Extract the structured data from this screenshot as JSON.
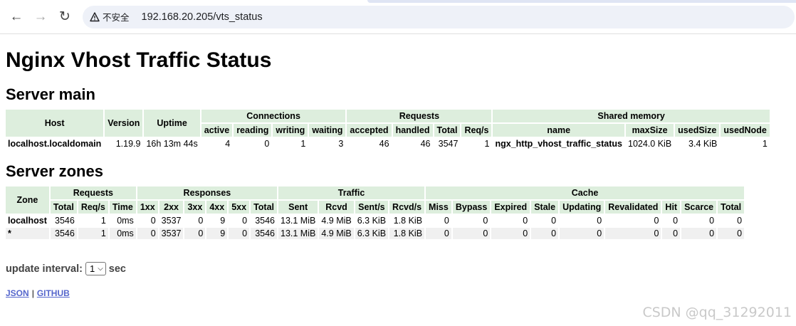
{
  "browser": {
    "back_icon": "arrow-left-icon",
    "forward_icon": "arrow-right-icon",
    "reload_icon": "reload-icon",
    "security_label": "不安全",
    "url": "192.168.20.205/vts_status"
  },
  "page": {
    "title": "Nginx Vhost Traffic Status",
    "server_main_heading": "Server main",
    "server_zones_heading": "Server zones",
    "update_interval_label": "update interval:",
    "update_interval_value": "1",
    "update_interval_unit": "sec",
    "link_json": "JSON",
    "link_separator": "|",
    "link_github": "GITHUB",
    "watermark": "CSDN @qq_31292011"
  },
  "server_main": {
    "group_headers": {
      "host": "Host",
      "version": "Version",
      "uptime": "Uptime",
      "connections": "Connections",
      "requests": "Requests",
      "shared_memory": "Shared memory"
    },
    "sub_headers": [
      "active",
      "reading",
      "writing",
      "waiting",
      "accepted",
      "handled",
      "Total",
      "Req/s",
      "name",
      "maxSize",
      "usedSize",
      "usedNode"
    ],
    "row": [
      "localhost.localdomain",
      "1.19.9",
      "16h 13m 44s",
      "4",
      "0",
      "1",
      "3",
      "46",
      "46",
      "3547",
      "1",
      "ngx_http_vhost_traffic_status",
      "1024.0 KiB",
      "3.4 KiB",
      "1"
    ]
  },
  "server_zones": {
    "group_headers": {
      "zone": "Zone",
      "requests": "Requests",
      "responses": "Responses",
      "traffic": "Traffic",
      "cache": "Cache"
    },
    "sub_headers": [
      "Total",
      "Req/s",
      "Time",
      "1xx",
      "2xx",
      "3xx",
      "4xx",
      "5xx",
      "Total",
      "Sent",
      "Rcvd",
      "Sent/s",
      "Rcvd/s",
      "Miss",
      "Bypass",
      "Expired",
      "Stale",
      "Updating",
      "Revalidated",
      "Hit",
      "Scarce",
      "Total"
    ],
    "rows": [
      [
        "localhost",
        "3546",
        "1",
        "0ms",
        "0",
        "3537",
        "0",
        "9",
        "0",
        "3546",
        "13.1 MiB",
        "4.9 MiB",
        "6.3 KiB",
        "1.8 KiB",
        "0",
        "0",
        "0",
        "0",
        "0",
        "0",
        "0",
        "0",
        "0"
      ],
      [
        "*",
        "3546",
        "1",
        "0ms",
        "0",
        "3537",
        "0",
        "9",
        "0",
        "3546",
        "13.1 MiB",
        "4.9 MiB",
        "6.3 KiB",
        "1.8 KiB",
        "0",
        "0",
        "0",
        "0",
        "0",
        "0",
        "0",
        "0",
        "0"
      ]
    ]
  }
}
